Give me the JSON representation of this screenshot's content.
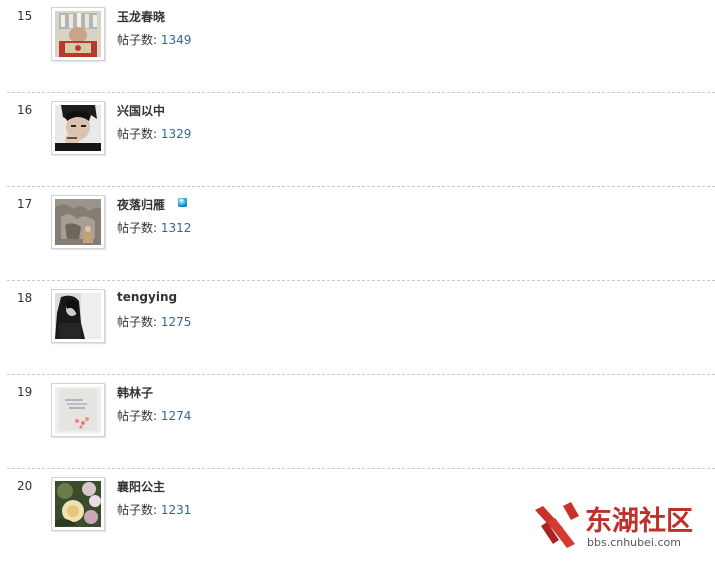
{
  "members": [
    {
      "rank": "15",
      "name": "玉龙春晓",
      "posts_label": "帖子数:",
      "posts": "1349",
      "online": false
    },
    {
      "rank": "16",
      "name": "兴国以中",
      "posts_label": "帖子数:",
      "posts": "1329",
      "online": false
    },
    {
      "rank": "17",
      "name": "夜落归雁",
      "posts_label": "帖子数:",
      "posts": "1312",
      "online": true
    },
    {
      "rank": "18",
      "name": "tengying",
      "posts_label": "帖子数:",
      "posts": "1275",
      "online": false
    },
    {
      "rank": "19",
      "name": "韩林子",
      "posts_label": "帖子数:",
      "posts": "1274",
      "online": false
    },
    {
      "rank": "20",
      "name": "襄阳公主",
      "posts_label": "帖子数:",
      "posts": "1231",
      "online": false
    }
  ],
  "watermark": {
    "title": "东湖社区",
    "url": "bbs.cnhubei.com"
  },
  "colors": {
    "link": "#336699",
    "separator": "#c9c9c9",
    "brand": "#c0302a"
  }
}
